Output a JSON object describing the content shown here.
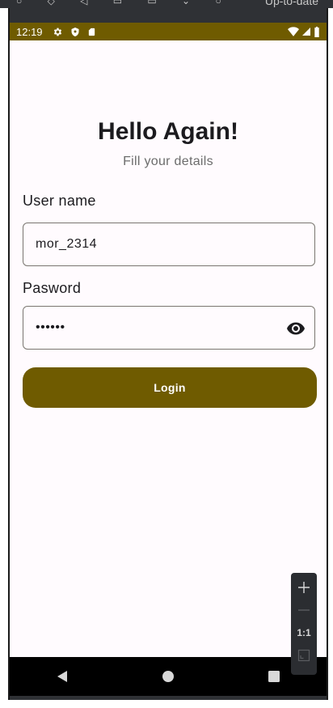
{
  "host": {
    "top_text": "Up-to-date"
  },
  "status_bar": {
    "time": "12:19",
    "background": "#6f5b00",
    "left_icons": [
      "gear-icon",
      "shield-icon",
      "sd-card-icon"
    ],
    "right_icons": [
      "wifi-icon",
      "signal-icon",
      "battery-icon"
    ]
  },
  "login": {
    "title": "Hello Again!",
    "subtitle": "Fill your details",
    "username": {
      "label": "User name",
      "value": "mor_2314"
    },
    "password": {
      "label": "Pasword",
      "value": "••••••",
      "toggle_icon": "eye-icon"
    },
    "button_label": "Login",
    "accent_color": "#6f5b00"
  },
  "nav_bar": {
    "buttons": [
      "back-icon",
      "home-icon",
      "recents-icon"
    ]
  },
  "zoom_panel": {
    "zoom_in_icon": "plus-icon",
    "zoom_out_icon": "minus-icon",
    "one_to_one_label": "1:1",
    "fit_icon": "fit-screen-icon"
  }
}
